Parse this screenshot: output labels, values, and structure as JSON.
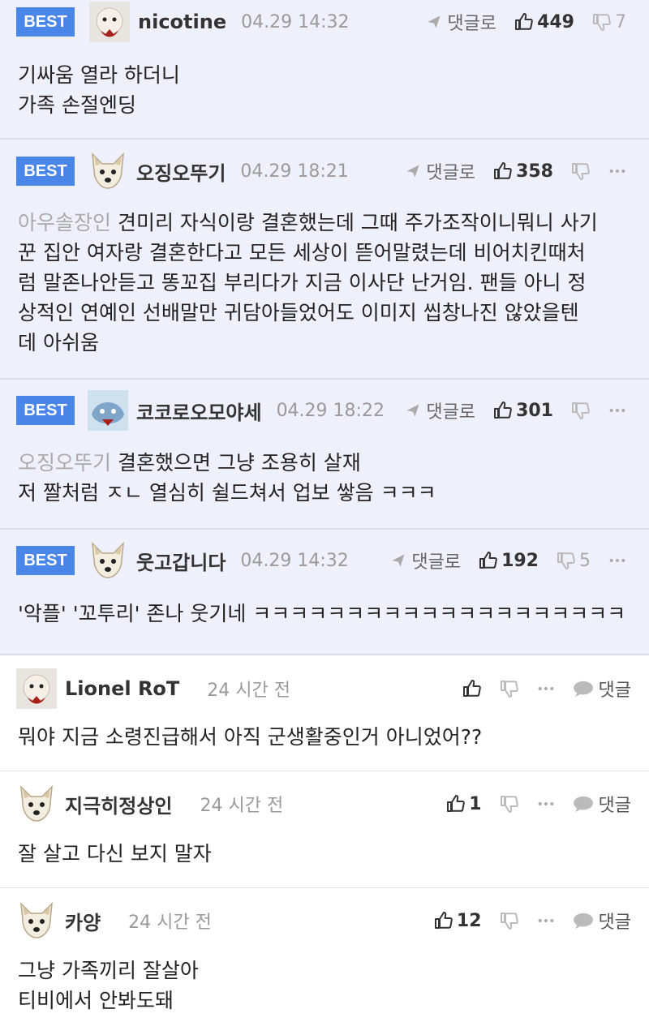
{
  "best_comments": [
    {
      "badge": "BEST",
      "nickname": "nicotine",
      "time": "04.29 14:32",
      "reply": "댓글로",
      "likes": "449",
      "dislikes": "7",
      "mention": "",
      "lines": [
        "기싸움 열라 하더니",
        "가족 손절엔딩"
      ]
    },
    {
      "badge": "BEST",
      "nickname": "오징오뚜기",
      "time": "04.29 18:21",
      "reply": "댓글로",
      "likes": "358",
      "dislikes": "",
      "mention": "아우솔장인",
      "lines": [
        "견미리 자식이랑 결혼했는데 그때 주가조작이니뭐니 사기",
        "꾼 집안 여자랑 결혼한다고 모든 세상이 뜯어말렸는데 비어치킨때처",
        "럼 말존나안듣고 똥꼬집 부리다가 지금 이사단 난거임. 팬들 아니 정",
        "상적인 연예인 선배말만 귀담아들었어도 이미지 씹창나진 않았을텐",
        "데 아쉬움"
      ]
    },
    {
      "badge": "BEST",
      "nickname": "코코로오모야세",
      "time": "04.29 18:22",
      "reply": "댓글로",
      "likes": "301",
      "dislikes": "",
      "mention": "오징오뚜기",
      "lines": [
        "결혼했으면 그냥 조용히 살재",
        "저 짤처럼 ㅈㄴ 열심히 쉴드쳐서 업보 쌓음 ㅋㅋㅋ"
      ]
    },
    {
      "badge": "BEST",
      "nickname": "웃고갑니다",
      "time": "04.29 14:32",
      "reply": "댓글로",
      "likes": "192",
      "dislikes": "5",
      "mention": "",
      "lines": [
        "'악플' '꼬투리' 존나 웃기네 ㅋㅋㅋㅋㅋㅋㅋㅋㅋㅋㅋㅋㅋㅋㅋㅋㅋㅋㅋㅋ"
      ]
    }
  ],
  "comments": [
    {
      "nickname": "Lionel RoT",
      "time": "24 시간 전",
      "likes": "",
      "reply": "댓글",
      "text": "뭐야 지금 소령진급해서 아직 군생활중인거 아니었어??"
    },
    {
      "nickname": "지극히정상인",
      "time": "24 시간 전",
      "likes": "1",
      "reply": "댓글",
      "text": "잘 살고 다신 보지 말자"
    },
    {
      "nickname": "카양",
      "time": "24 시간 전",
      "likes": "12",
      "reply": "댓글",
      "lines": [
        "그냥 가족끼리 잘살아",
        "티비에서 안봐도돼"
      ]
    }
  ],
  "icons": {
    "reply": "reply-arrow-icon",
    "like": "thumbs-up-icon",
    "dislike": "thumbs-down-icon",
    "more": "more-dots-icon",
    "chat": "chat-bubble-icon"
  },
  "colors": {
    "badge": "#4a86e8",
    "best_bg": "#eef0fb",
    "mention": "#aaaaaa"
  }
}
